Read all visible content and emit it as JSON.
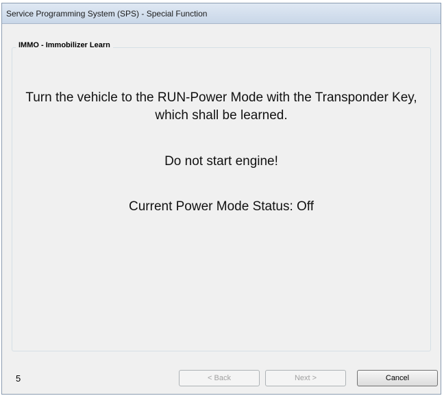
{
  "window": {
    "title": "Service Programming System (SPS) - Special Function"
  },
  "group": {
    "title": "IMMO - Immobilizer Learn"
  },
  "message": {
    "line1": "Turn the vehicle to the RUN-Power Mode with the Transponder Key,",
    "line2": "which shall be learned.",
    "warning": "Do not start engine!",
    "status": "Current Power Mode Status: Off"
  },
  "footer": {
    "step_number": "5",
    "back_label": "< Back",
    "next_label": "Next >",
    "cancel_label": "Cancel"
  }
}
